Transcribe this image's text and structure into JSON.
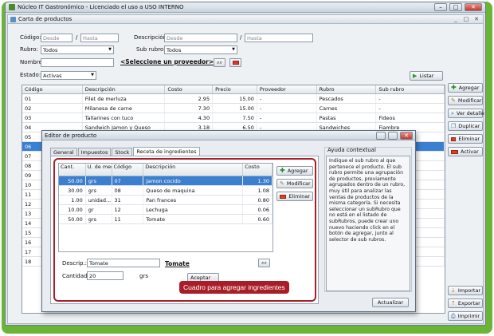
{
  "app": {
    "title": "Núcleo IT Gastronómico - Licenciado el uso a USO INTERNO",
    "minimize": "–",
    "maximize": "□",
    "close": "✕"
  },
  "child": {
    "title": "Carta de productos",
    "minimize": "_",
    "maximize": "□",
    "close": "✕"
  },
  "filters": {
    "codigo_label": "Código:",
    "codigo_desde": "Desde",
    "codigo_sep": "/",
    "codigo_hasta": "Hasta",
    "descripcion_label": "Descripción:",
    "descripcion_desde": "Desde",
    "descripcion_sep": "/",
    "descripcion_hasta": "Hasta",
    "rubro_label": "Rubro:",
    "rubro_value": "Todos",
    "subrubro_label": "Sub rubro:",
    "subrubro_value": "Todos",
    "nombre_label": "Nombre:",
    "proveedor_link": "<Seleccione un proveedor>",
    "estado_label": "Estado:",
    "estado_value": "Activas",
    "listar_label": "Listar"
  },
  "grid": {
    "columns": [
      "Código",
      "Descripción",
      "Costo",
      "Precio",
      "Proveedor",
      "Rubro",
      "Sub rubro"
    ],
    "rows": [
      [
        "01",
        "Filet de merluza",
        "2.95",
        "15.00",
        "-",
        "Pescados",
        "-"
      ],
      [
        "02",
        "Milanesa de carne",
        "7.30",
        "15.00",
        "-",
        "Carnes",
        "-"
      ],
      [
        "03",
        "Tallarines con tuco",
        "4.30",
        "7.50",
        "-",
        "Pastas",
        "Fideos"
      ],
      [
        "04",
        "Sandwich Jamon y Queso",
        "3.18",
        "6.50",
        "-",
        "Sandwiches",
        "Fiambre"
      ],
      [
        "05",
        "",
        "",
        "",
        "",
        "",
        ""
      ],
      [
        "06",
        "",
        "",
        "",
        "",
        "",
        ""
      ],
      [
        "07",
        "",
        "",
        "",
        "",
        "",
        ""
      ],
      [
        "08",
        "",
        "",
        "",
        "",
        "",
        ""
      ],
      [
        "09",
        "",
        "",
        "",
        "",
        "",
        ""
      ],
      [
        "10",
        "",
        "",
        "",
        "",
        "",
        ""
      ],
      [
        "11",
        "",
        "",
        "",
        "",
        "",
        ""
      ],
      [
        "12",
        "",
        "",
        "",
        "",
        "",
        ""
      ],
      [
        "13",
        "",
        "",
        "",
        "",
        "",
        ""
      ],
      [
        "14",
        "",
        "",
        "",
        "",
        "",
        ""
      ],
      [
        "15",
        "",
        "",
        "",
        "",
        "",
        ""
      ],
      [
        "16",
        "",
        "",
        "",
        "",
        "",
        ""
      ],
      [
        "17",
        "",
        "",
        "",
        "",
        "",
        ""
      ],
      [
        "18",
        "",
        "",
        "",
        "",
        "",
        ""
      ]
    ],
    "selected_index": 5
  },
  "side_buttons": {
    "agregar": "Agregar",
    "modificar": "Modificar",
    "ver_detalle": "Ver detalle",
    "duplicar": "Duplicar",
    "eliminar": "Eliminar",
    "activar": "Activar",
    "importar": "Importar",
    "exportar": "Exportar",
    "imprimir": "Imprimir"
  },
  "editor": {
    "title": "Editor de producto",
    "tabs": [
      "General",
      "Impuestos",
      "Stock",
      "Receta de ingredientes"
    ],
    "active_tab": 3,
    "ing_columns": [
      "Cant.",
      "U. de medida",
      "Código",
      "Descripción",
      "Costo"
    ],
    "ing_rows": [
      [
        "50.00",
        "grs",
        "07",
        "Jamon cocido",
        "1.30"
      ],
      [
        "30.00",
        "grs",
        "08",
        "Queso de maquina",
        "1.08"
      ],
      [
        "1.00",
        "unidad...",
        "31",
        "Pan frances",
        "0.80"
      ],
      [
        "10.00",
        "gr",
        "12",
        "Lechuga",
        "0.06"
      ],
      [
        "50.00",
        "grs",
        "11",
        "Tomate",
        "0.60"
      ]
    ],
    "selected_ing": 0,
    "agregar": "Agregar",
    "modificar": "Modificar",
    "eliminar": "Eliminar",
    "descrip_label": "Descrip.:",
    "descrip_value": "Tomate",
    "descrip_link": "Tomate",
    "cantidad_label": "Cantidad:",
    "cantidad_value": "20",
    "cantidad_unit": "grs",
    "aceptar": "Aceptar",
    "ayuda_title": "Ayuda contextual",
    "ayuda_text": "Indique el sub rubro al que pertenece el producto. El sub rubro permite una agrupación de productos, previamente agrupados dentro de un rubro, muy útil para analizar las ventas de productos de la misma categoría. Si necesita seleccionar un subRubro que no está en el listado de subRubros, puede crear uno nuevo haciendo click en el botón de agregar, junto al selector de sub rubros.",
    "actualizar": "Actualizar"
  },
  "callout": "Cuadro para agregar ingredientes",
  "colors": {
    "frame_green": "#6bb536",
    "selection_blue": "#3b7fd0",
    "callout_red": "#a81d27"
  }
}
